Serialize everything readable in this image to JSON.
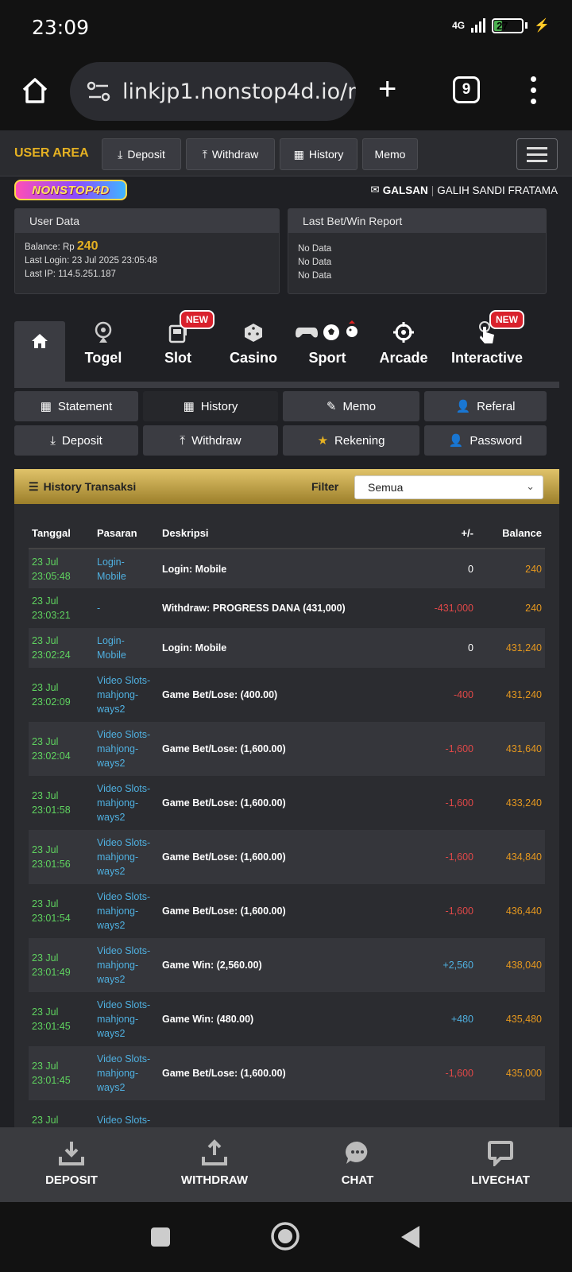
{
  "status_bar": {
    "time": "23:09",
    "network": "4G",
    "battery": "27",
    "battery_level": 0.27
  },
  "browser": {
    "url": "linkjp1.nonstop4d.io/m",
    "tab_count": "9"
  },
  "top_nav": {
    "user_area": "USER AREA",
    "buttons": [
      "Deposit",
      "Withdraw",
      "History",
      "Memo"
    ]
  },
  "brand": {
    "logo_text": "NONSTOP4D"
  },
  "user": {
    "username": "GALSAN",
    "fullname": "GALIH SANDI FRATAMA"
  },
  "user_data": {
    "title": "User Data",
    "balance_label": "Balance: Rp",
    "balance_value": "240",
    "last_login": "Last Login: 23 Jul 2025 23:05:48",
    "last_ip": "Last IP: 114.5.251.187"
  },
  "last_bet": {
    "title": "Last Bet/Win Report",
    "lines": [
      "No Data",
      "No Data",
      "No Data"
    ]
  },
  "categories": {
    "items": [
      "Togel",
      "Slot",
      "Casino",
      "Sport",
      "Arcade",
      "Interactive"
    ],
    "new_badge": "NEW"
  },
  "sub_buttons": [
    "Statement",
    "History",
    "Memo",
    "Referal",
    "Deposit",
    "Withdraw",
    "Rekening",
    "Password"
  ],
  "history": {
    "title": "History Transaksi",
    "filter_label": "Filter",
    "filter_value": "Semua",
    "columns": [
      "Tanggal",
      "Pasaran",
      "Deskripsi",
      "+/-",
      "Balance"
    ],
    "rows": [
      {
        "date": "23 Jul",
        "time": "23:05:48",
        "pasaran": [
          "Login-",
          "Mobile"
        ],
        "desc": "Login: Mobile",
        "amount": "0",
        "balance": "240"
      },
      {
        "date": "23 Jul",
        "time": "23:03:21",
        "pasaran": [
          "-"
        ],
        "desc": "Withdraw: PROGRESS DANA (431,000)",
        "amount": "-431,000",
        "balance": "240"
      },
      {
        "date": "23 Jul",
        "time": "23:02:24",
        "pasaran": [
          "Login-",
          "Mobile"
        ],
        "desc": "Login: Mobile",
        "amount": "0",
        "balance": "431,240"
      },
      {
        "date": "23 Jul",
        "time": "23:02:09",
        "pasaran": [
          "Video Slots-",
          "mahjong-",
          "ways2"
        ],
        "desc": "Game Bet/Lose: (400.00)",
        "amount": "-400",
        "balance": "431,240"
      },
      {
        "date": "23 Jul",
        "time": "23:02:04",
        "pasaran": [
          "Video Slots-",
          "mahjong-",
          "ways2"
        ],
        "desc": "Game Bet/Lose: (1,600.00)",
        "amount": "-1,600",
        "balance": "431,640"
      },
      {
        "date": "23 Jul",
        "time": "23:01:58",
        "pasaran": [
          "Video Slots-",
          "mahjong-",
          "ways2"
        ],
        "desc": "Game Bet/Lose: (1,600.00)",
        "amount": "-1,600",
        "balance": "433,240"
      },
      {
        "date": "23 Jul",
        "time": "23:01:56",
        "pasaran": [
          "Video Slots-",
          "mahjong-",
          "ways2"
        ],
        "desc": "Game Bet/Lose: (1,600.00)",
        "amount": "-1,600",
        "balance": "434,840"
      },
      {
        "date": "23 Jul",
        "time": "23:01:54",
        "pasaran": [
          "Video Slots-",
          "mahjong-",
          "ways2"
        ],
        "desc": "Game Bet/Lose: (1,600.00)",
        "amount": "-1,600",
        "balance": "436,440"
      },
      {
        "date": "23 Jul",
        "time": "23:01:49",
        "pasaran": [
          "Video Slots-",
          "mahjong-",
          "ways2"
        ],
        "desc": "Game Win: (2,560.00)",
        "amount": "+2,560",
        "balance": "438,040"
      },
      {
        "date": "23 Jul",
        "time": "23:01:45",
        "pasaran": [
          "Video Slots-",
          "mahjong-",
          "ways2"
        ],
        "desc": "Game Win: (480.00)",
        "amount": "+480",
        "balance": "435,480"
      },
      {
        "date": "23 Jul",
        "time": "23:01:45",
        "pasaran": [
          "Video Slots-",
          "mahjong-",
          "ways2"
        ],
        "desc": "Game Bet/Lose: (1,600.00)",
        "amount": "-1,600",
        "balance": "435,000"
      },
      {
        "date": "23 Jul",
        "time": "",
        "pasaran": [
          "Video Slots-"
        ],
        "desc": "",
        "amount": "",
        "balance": ""
      }
    ]
  },
  "app_nav": [
    "DEPOSIT",
    "WITHDRAW",
    "CHAT",
    "LIVECHAT"
  ],
  "colors": {
    "accent_gold": "#e5b122",
    "date_green": "#5fd35f",
    "link_blue": "#4fb0e0",
    "negative_red": "#e04848",
    "balance_orange": "#e5981f",
    "new_badge_red": "#d9212c"
  }
}
